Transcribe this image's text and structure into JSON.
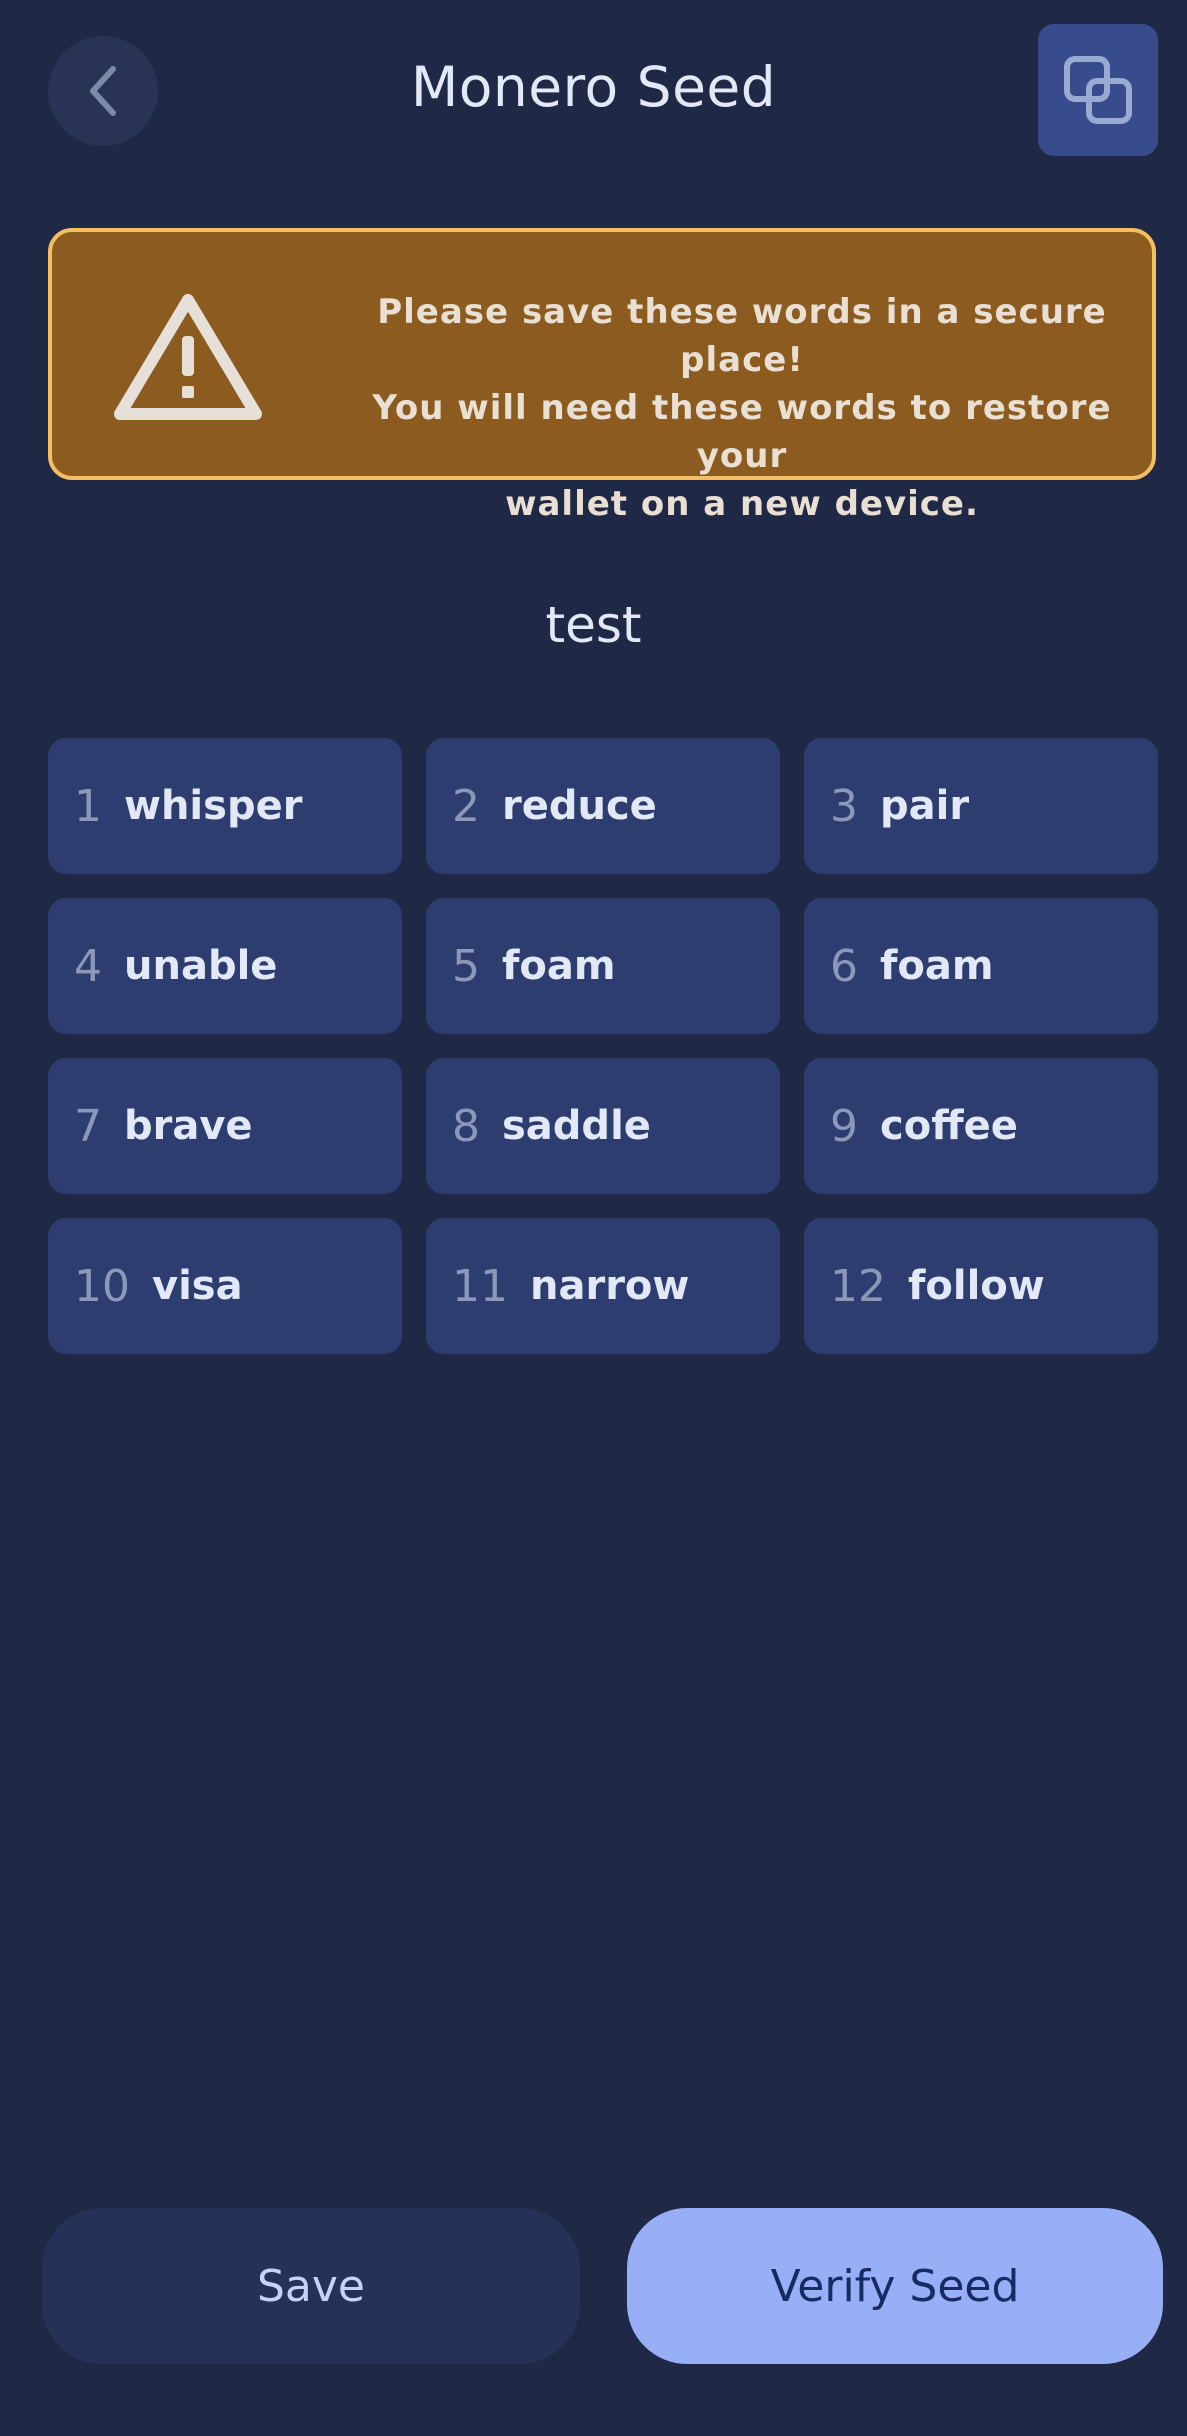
{
  "header": {
    "title": "Monero Seed",
    "back_icon": "chevron-left-icon",
    "copy_icon": "copy-icon"
  },
  "warning": {
    "icon": "warning-icon",
    "lines": [
      "Please save these words in a secure place!",
      "You will need these words to restore your",
      "wallet on a new device."
    ]
  },
  "wallet": {
    "name": "test"
  },
  "seed": [
    {
      "number": "1",
      "word": "whisper"
    },
    {
      "number": "2",
      "word": "reduce"
    },
    {
      "number": "3",
      "word": "pair"
    },
    {
      "number": "4",
      "word": "unable"
    },
    {
      "number": "5",
      "word": "foam"
    },
    {
      "number": "6",
      "word": "foam"
    },
    {
      "number": "7",
      "word": "brave"
    },
    {
      "number": "8",
      "word": "saddle"
    },
    {
      "number": "9",
      "word": "coffee"
    },
    {
      "number": "10",
      "word": "visa"
    },
    {
      "number": "11",
      "word": "narrow"
    },
    {
      "number": "12",
      "word": "follow"
    }
  ],
  "actions": {
    "save_label": "Save",
    "verify_label": "Verify Seed"
  },
  "colors": {
    "background": "#1f2946",
    "card": "#2e3d70",
    "warning_fill": "#8b5b1f",
    "warning_border": "#f4be61",
    "primary_button": "#98aff8"
  }
}
